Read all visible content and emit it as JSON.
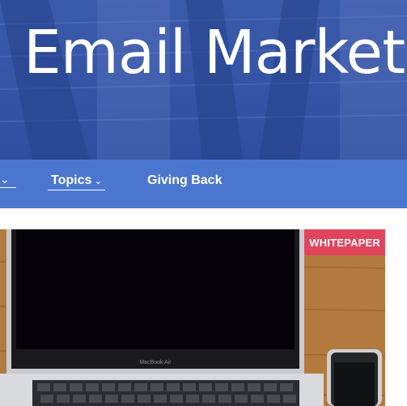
{
  "hero": {
    "title": "Email Marketi"
  },
  "nav": {
    "partial_left_chevron": "⌄",
    "items": [
      {
        "label": "Topics",
        "chevron": "⌄"
      },
      {
        "label": "Giving Back"
      }
    ]
  },
  "card": {
    "badge": "WHITEPAPER",
    "laptop_brand": "MacBook Air"
  },
  "colors": {
    "hero_bg": "#3554a6",
    "nav_bg": "#4a76cf",
    "badge_bg": "#e0455c"
  }
}
